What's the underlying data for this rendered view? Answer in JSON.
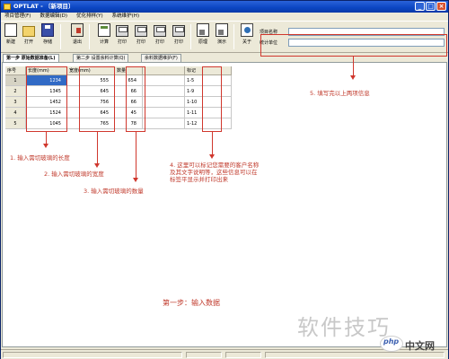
{
  "window": {
    "title": "OPTLAT - 〔新项目〕",
    "controls": {
      "minimize": "_",
      "maximize": "□",
      "close": "×"
    }
  },
  "menu": [
    "项目管理(F)",
    "数据编辑(D)",
    "优化排样(Y)",
    "系统维护(H)"
  ],
  "toolbar": {
    "buttons": [
      {
        "label": "新建",
        "icon": "new-file-icon"
      },
      {
        "label": "打开",
        "icon": "open-folder-icon"
      },
      {
        "label": "存储",
        "icon": "save-disk-icon"
      },
      {
        "label": "退出",
        "icon": "exit-door-icon"
      },
      {
        "label": "计算",
        "icon": "calculate-icon"
      },
      {
        "label": "打印",
        "icon": "printer-icon"
      },
      {
        "label": "打印",
        "icon": "printer-icon"
      },
      {
        "label": "打印",
        "icon": "printer-icon"
      },
      {
        "label": "打印",
        "icon": "printer-icon"
      },
      {
        "label": "原理",
        "icon": "tile-layout-icon"
      },
      {
        "label": "演示",
        "icon": "demo-icon"
      },
      {
        "label": "关于",
        "icon": "about-icon"
      }
    ],
    "project": {
      "name_label": "项目名称",
      "name_value": "",
      "unit_label": "统计单位",
      "unit_value": ""
    }
  },
  "tabs": [
    {
      "label": "第一步  原始数据准备(L)",
      "active": true
    },
    {
      "label": "第二步  设置余料计算(Q)",
      "active": false
    },
    {
      "label": "余料数据维护(F)",
      "active": false
    }
  ],
  "grid": {
    "columns": [
      "序号",
      "长度(mm)",
      "宽度(mm)",
      "数量",
      "",
      "标记"
    ],
    "rows": [
      {
        "no": "1",
        "length": "1234",
        "width": "555",
        "qty": "654",
        "mark": "1-5",
        "selected": true
      },
      {
        "no": "2",
        "length": "1345",
        "width": "645",
        "qty": "66",
        "mark": "1-9",
        "selected": false
      },
      {
        "no": "3",
        "length": "1452",
        "width": "756",
        "qty": "66",
        "mark": "1-10",
        "selected": false
      },
      {
        "no": "4",
        "length": "1524",
        "width": "645",
        "qty": "45",
        "mark": "1-11",
        "selected": false
      },
      {
        "no": "5",
        "length": "1045",
        "width": "765",
        "qty": "78",
        "mark": "1-12",
        "selected": false
      }
    ]
  },
  "annotations": {
    "note1": "1. 输入需切玻璃的长度",
    "note2": "2. 输入需切玻璃的宽度",
    "note3": "3. 输入需切玻璃的数量",
    "note4": "4. 这里可以标记您需要的客户名称及其文字说明等，这些信息可以在标签平显示并打印出来",
    "note5": "5. 填写完以上两项信息",
    "step": "第一步：输入数据",
    "color": "#d0372d"
  },
  "watermark": {
    "text": "软件技巧",
    "logo": "php",
    "site": "中文网"
  }
}
